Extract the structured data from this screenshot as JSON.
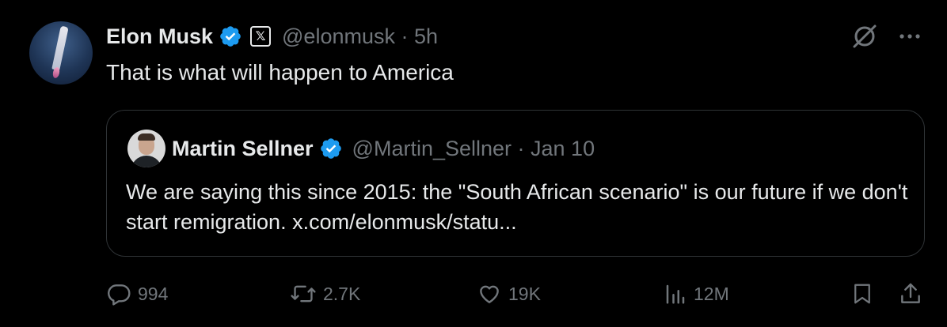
{
  "author": {
    "name": "Elon Musk",
    "handle": "@elonmusk · 5h",
    "affiliation_badge_text": "𝕏",
    "verified": true
  },
  "tweet": {
    "text": "That is what will happen to America"
  },
  "quoted": {
    "name": "Martin Sellner",
    "handle": "@Martin_Sellner · Jan 10",
    "verified": true,
    "text": "We are saying this since 2015: the \"South African scenario\" is our future if we don't start remigration. x.com/elonmusk/statu..."
  },
  "actions": {
    "replies": "994",
    "reposts": "2.7K",
    "likes": "19K",
    "views": "12M"
  },
  "icons": {
    "verified": "verified-badge-icon",
    "grok": "grok-icon",
    "more": "more-icon",
    "reply": "reply-icon",
    "repost": "repost-icon",
    "like": "like-icon",
    "views": "views-icon",
    "bookmark": "bookmark-icon",
    "share": "share-icon"
  },
  "colors": {
    "background": "#000000",
    "text": "#e7e9ea",
    "secondary": "#71767b",
    "verified": "#1d9bf0",
    "border": "#2f3336"
  }
}
